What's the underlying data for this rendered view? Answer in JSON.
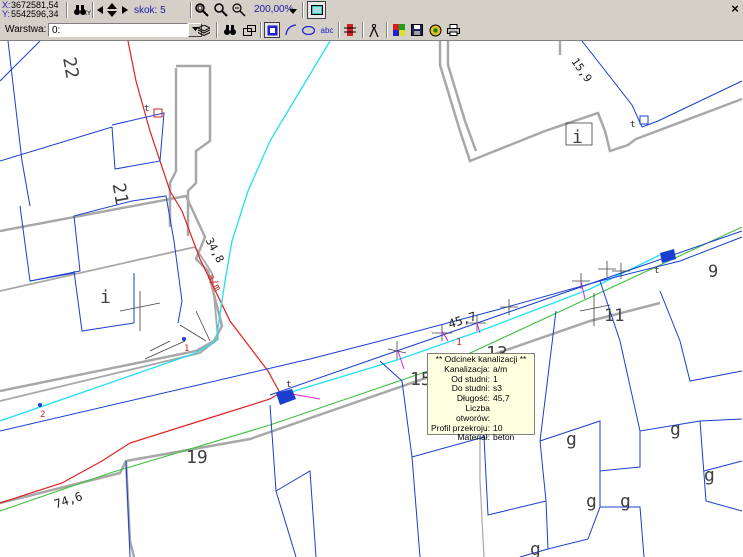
{
  "coords": {
    "x_label": "X:",
    "x_value": "3672581,54",
    "y_label": "Y:",
    "y_value": "5542596,34"
  },
  "toolbar": {
    "step_label": "skok: 5",
    "zoom_value": "200,00%",
    "xy_label": "XY",
    "abc_label": "abc",
    "close_label": "×"
  },
  "layer": {
    "label": "Warstwa:",
    "value": "0:"
  },
  "map_labels": {
    "parcel_22": "22",
    "parcel_21": "21",
    "parcel_19": "19",
    "parcel_15": "15",
    "parcel_13": "13",
    "parcel_11": "11",
    "parcel_9": "9",
    "len_34_8": "34,8",
    "len_15_9": "15,9",
    "len_45_7": "45,7",
    "len_74_6": "74,6",
    "am": "a/m",
    "i1": "i",
    "i2": "i",
    "g1": "g",
    "g2": "g",
    "g3": "g",
    "g4": "g",
    "g5": "g",
    "g6": "g",
    "t1": "t",
    "t2": "t",
    "t3": "t",
    "t4": "t",
    "n1": "1",
    "n1b": "1",
    "n2": "2"
  },
  "tooltip": {
    "title": "** Odcinek kanalizacji **",
    "rows": [
      {
        "k": "Kanalizacja:",
        "v": "a/m"
      },
      {
        "k": "Od studni:",
        "v": "1"
      },
      {
        "k": "Do studni:",
        "v": "s3"
      },
      {
        "k": "Długość:",
        "v": "45,7"
      },
      {
        "k": "Liczba otworów:",
        "v": ""
      },
      {
        "k": "Profil przekroju:",
        "v": "10"
      },
      {
        "k": "Materiał:",
        "v": "beton"
      }
    ]
  },
  "colors": {
    "parcel": "#1a3fd0",
    "sewer": "#e02020",
    "water": "#20e0f0",
    "gas": "#40c040",
    "building": "#a8a8a8",
    "tooltip_bg": "#ffffe1"
  },
  "icons": [
    "binoculars-icon",
    "arrow-left-icon",
    "arrow-up-down-icon",
    "arrow-right-icon",
    "zoom-window-icon",
    "zoom-in-icon",
    "zoom-out-icon",
    "chevron-down-icon",
    "map-view-icon",
    "layers-icon",
    "binoculars-icon",
    "rectangle-icon",
    "select-icon",
    "arc-icon",
    "ellipse-icon",
    "measure-icon",
    "compass-icon",
    "palette-icon",
    "save-icon",
    "globe-icon",
    "print-icon"
  ]
}
